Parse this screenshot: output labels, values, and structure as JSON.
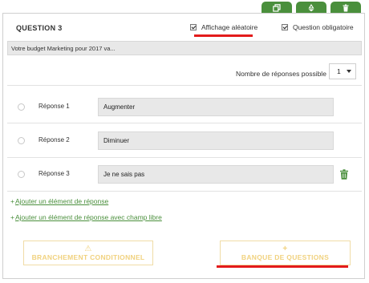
{
  "tabs": [
    {
      "icon": "duplicate-icon"
    },
    {
      "icon": "recycle-icon"
    },
    {
      "icon": "trash-icon"
    }
  ],
  "question": {
    "title": "QUESTION 3",
    "random_display_label": "Affichage aléatoire",
    "random_display_checked": true,
    "required_label": "Question obligatoire",
    "required_checked": true,
    "text": "Votre budget Marketing pour 2017 va..."
  },
  "responses_count": {
    "label": "Nombre de réponses possible",
    "value": "1"
  },
  "answers": [
    {
      "label": "Réponse 1",
      "value": "Augmenter"
    },
    {
      "label": "Réponse 2",
      "value": "Diminuer"
    },
    {
      "label": "Réponse 3",
      "value": "Je ne sais pas"
    }
  ],
  "links": {
    "add_element": "Ajouter un élément de réponse",
    "add_element_free": "Ajouter un élément de réponse avec champ libre"
  },
  "buttons": {
    "branch": "BRANCHEMENT CONDITIONNEL",
    "bank": "BANQUE DE QUESTIONS"
  },
  "colors": {
    "accent_green": "#4a8f3c",
    "highlight_red": "#e31b1b",
    "button_gold": "#f1d27f"
  }
}
